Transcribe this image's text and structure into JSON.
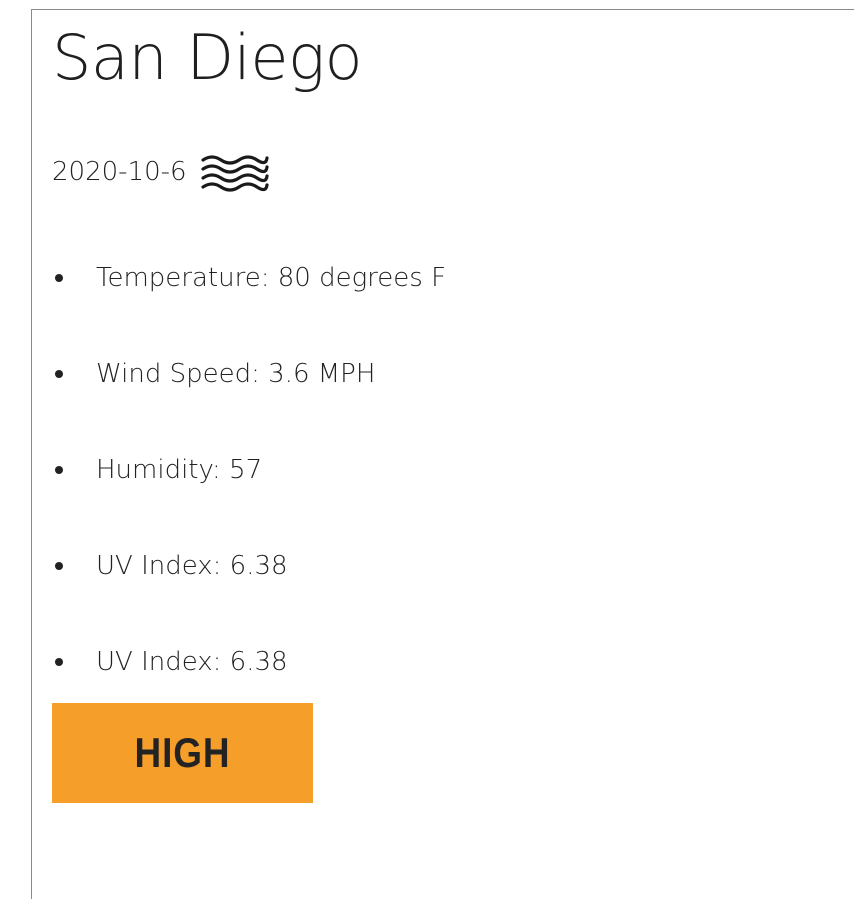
{
  "city": "San Diego",
  "date": "2020-10-6",
  "weather_icon": "haze-icon",
  "details": [
    {
      "label": "Temperature: 80 degrees F"
    },
    {
      "label": "Wind Speed: 3.6 MPH"
    },
    {
      "label": "Humidity: 57"
    },
    {
      "label": "UV Index: 6.38"
    },
    {
      "label": "UV Index: 6.38"
    }
  ],
  "uv_badge": {
    "label": "HIGH",
    "color": "#f69e2a"
  },
  "colors": {
    "text": "#222222",
    "border": "#8a8a8a"
  }
}
